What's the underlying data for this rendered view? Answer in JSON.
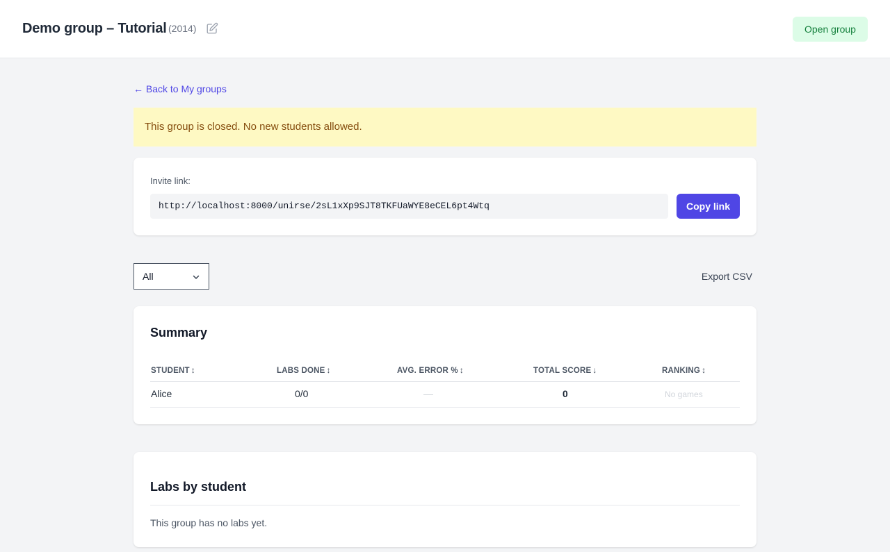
{
  "header": {
    "title": "Demo group – Tutorial",
    "year": "(2014)",
    "edit_icon": "pencil-square-icon",
    "open_button": "Open group"
  },
  "nav": {
    "back_link": "← Back to My groups"
  },
  "alert": {
    "message": "This group is closed. No new students allowed."
  },
  "invite": {
    "label": "Invite link:",
    "url": "http://localhost:8000/unirse/2sL1xXp9SJT8TKFUaWYE8eCEL6pt4Wtq",
    "copy_button": "Copy link"
  },
  "filter": {
    "selected": "All",
    "icon": "chevron-down-icon"
  },
  "export_button": "Export CSV",
  "summary": {
    "title": "Summary",
    "columns": [
      {
        "label": "STUDENT",
        "sort": "↕"
      },
      {
        "label": "LABS DONE",
        "sort": "↕"
      },
      {
        "label": "AVG. ERROR %",
        "sort": "↕"
      },
      {
        "label": "TOTAL SCORE",
        "sort": "↓"
      },
      {
        "label": "RANKING",
        "sort": "↕"
      }
    ],
    "rows": [
      {
        "student": "Alice",
        "labs_done": "0/0",
        "avg_error": "—",
        "total_score": "0",
        "ranking": "No games"
      }
    ]
  },
  "labs": {
    "title": "Labs by student",
    "empty_message": "This group has no labs yet."
  },
  "colors": {
    "accent": "#4f46e5",
    "open_bg": "#dcfce7",
    "open_text": "#15803d",
    "alert_bg": "#fef9c3",
    "alert_text": "#854d0e",
    "page_bg": "#f3f4f6"
  }
}
